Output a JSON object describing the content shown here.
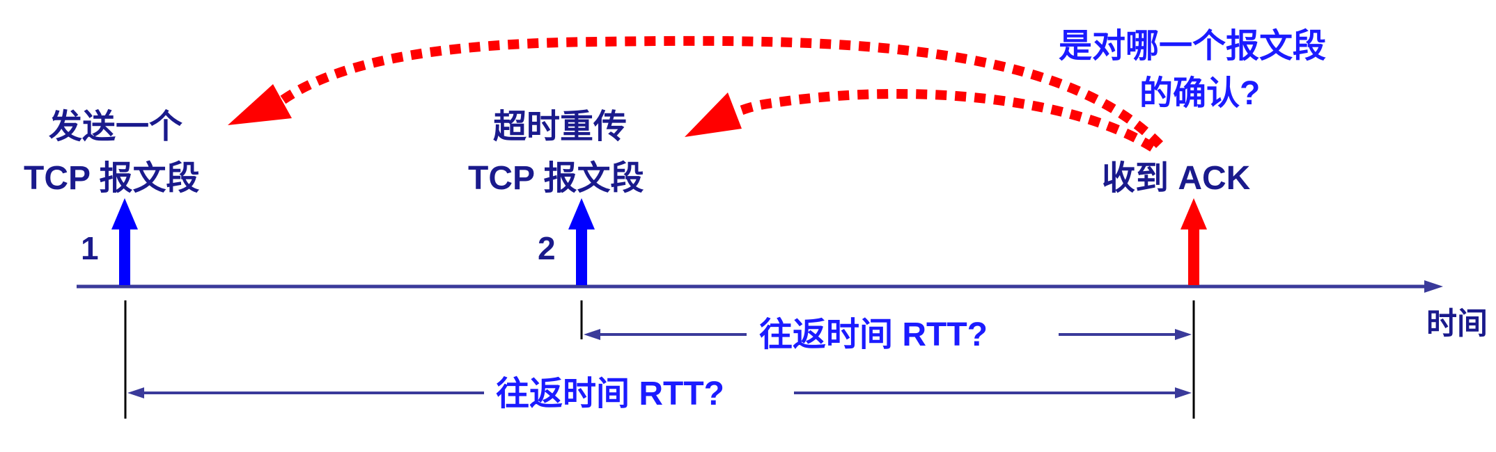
{
  "events": [
    {
      "label_line1": "发送一个",
      "label_line2": "TCP 报文段",
      "number": "1"
    },
    {
      "label_line1": "超时重传",
      "label_line2": "TCP 报文段",
      "number": "2"
    },
    {
      "label_line1": "收到 ACK",
      "label_line2": "",
      "number": ""
    }
  ],
  "question": {
    "line1": "是对哪一个报文段",
    "line2": "的确认?"
  },
  "axis_label": "时间",
  "rtt_labels": {
    "short": "往返时间 RTT?",
    "long": "往返时间 RTT?"
  },
  "colors": {
    "navy": "#1a1a8c",
    "axis": "#3a3a9a",
    "blue": "#0000ff",
    "red": "#ff0000",
    "rtt_text": "#1b1bff"
  }
}
